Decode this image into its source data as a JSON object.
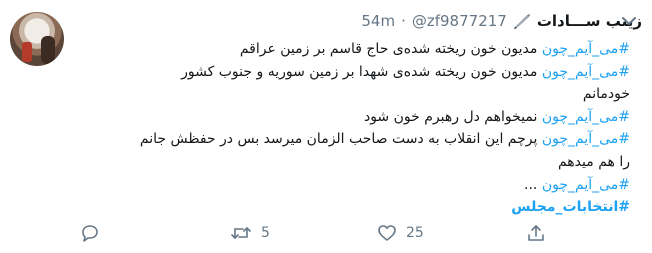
{
  "tweet": {
    "display_name": "زینب ســـادات",
    "handle": "@zf9877217",
    "separator": "·",
    "time": "54m",
    "lines": [
      {
        "hashtag": "#می_آیم_چون",
        "text": " مدیون خون ریخته شده‌ی حاج قاسم بر زمین عراقم"
      },
      {
        "hashtag": "#می_آیم_چون",
        "text": " مدیون خون ریخته شده‌ی شهدا بر زمین سوریه و جنوب کشور"
      },
      {
        "hashtag": "",
        "text": "خودمانم"
      },
      {
        "hashtag": "#می_آیم_چون",
        "text": " نمیخواهم دل رهبرم خون شود"
      },
      {
        "hashtag": "#می_آیم_چون",
        "text": " پرچم این انقلاب به دست صاحب الزمان میرسد بس در حفظش جانم"
      },
      {
        "hashtag": "",
        "text": "را هم میدهم"
      },
      {
        "hashtag": "#می_آیم_چون",
        "text": " ..."
      }
    ],
    "final_hashtag": "#انتخابات_مجلس",
    "retweet_count": "5",
    "like_count": "25",
    "colors": {
      "link": "#1da1f2",
      "muted": "#657786",
      "text": "#14171a"
    },
    "icons": [
      "quill-icon",
      "chevron-down-icon",
      "reply-icon",
      "retweet-icon",
      "like-icon",
      "share-icon"
    ]
  }
}
